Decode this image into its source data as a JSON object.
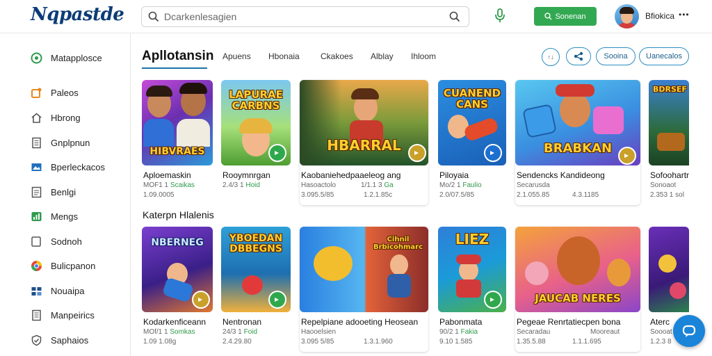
{
  "header": {
    "logo": "Nqpastde",
    "search_placeholder": "Dcarkenlesagien",
    "signin_label": "Sonenan",
    "username": "Bfiokica",
    "menu_glyph": "•••"
  },
  "sidebar": {
    "items": [
      {
        "label": "Matapplosce",
        "icon": "compass-icon"
      },
      {
        "label": "Paleos",
        "icon": "puzzle-icon"
      },
      {
        "label": "Hbrong",
        "icon": "home-icon"
      },
      {
        "label": "Gnplpnun",
        "icon": "document-icon"
      },
      {
        "label": "Bperleckacos",
        "icon": "image-icon"
      },
      {
        "label": "Benlgi",
        "icon": "list-icon"
      },
      {
        "label": "Mengs",
        "icon": "chart-icon"
      },
      {
        "label": "Sodnoh",
        "icon": "folder-icon"
      },
      {
        "label": "Bulicpanon",
        "icon": "globe-icon"
      },
      {
        "label": "Nouaipa",
        "icon": "grid-icon"
      },
      {
        "label": "Manpeirics",
        "icon": "page-icon"
      },
      {
        "label": "Saphaios",
        "icon": "shield-icon"
      }
    ]
  },
  "tabs": {
    "active": "Apllotansin",
    "items": [
      "Apuens",
      "Hbonaia",
      "Ckakoes",
      "Alblay",
      "Ihloom"
    ]
  },
  "toolbar": {
    "circle1_glyph": "↑↓",
    "pill1": "Sooina",
    "pill2": "Uanecalos"
  },
  "row1": [
    {
      "thumb_text": "HIBVRAES",
      "name": "Aploemaskin",
      "meta1a": "MOF1 1",
      "meta1b": "Scaikas",
      "meta2": "1.09.0005"
    },
    {
      "thumb_text": "LAPURAE CARBNS",
      "name": "Rooymnrgan",
      "meta1a": "2.4/3 1",
      "meta1b": "Hoid",
      "meta2": ""
    },
    {
      "thumb_text": "HBARRAL",
      "name": "Kaobaniehedpaaeleog ang",
      "meta1a": "Hasoactolo",
      "meta1b": "1/1.1 3",
      "meta1c": "Ga",
      "meta2": "3.095.5/85",
      "meta2b": "1.2.1.85c"
    },
    {
      "thumb_text": "CUANEND CANS",
      "name": "Piloyaia",
      "meta1a": "Mo/2 1",
      "meta1b": "Faulio",
      "meta2": "2.0/07.5/85"
    },
    {
      "thumb_text": "BRABKAN",
      "name": "Sendencks Kandideong",
      "meta1a": "Secarusda",
      "meta1b": "",
      "meta2": "2.1.055.85",
      "meta2b": "4.3.1185"
    },
    {
      "thumb_text": "BDRSEF",
      "name": "Sofoohartr",
      "meta1a": "Sonoaot",
      "meta1b": "",
      "meta2": "2.353 1 sol"
    }
  ],
  "section_title": "Katerpn Hlalenis",
  "row2": [
    {
      "thumb_text": "NBERNEG",
      "name": "Kodarkenficeann",
      "meta1a": "MOf/1 1",
      "meta1b": "Somkas",
      "meta2": "1.09 1.08g"
    },
    {
      "thumb_text": "YBOEDAN DBBEGNS",
      "name": "Nentronan",
      "meta1a": "24/3 1",
      "meta1b": "Foid",
      "meta2": "2.4.29.80"
    },
    {
      "thumb_text": "Cihnil Brbicohmarc",
      "name": "Repelpiane adooeting Heosean",
      "meta1a": "Haooelsien",
      "meta1b": "",
      "meta2": "3.095 5/85",
      "meta2b": "1.3.1.960"
    },
    {
      "thumb_text": "LIEZ",
      "name": "Pabonmata",
      "meta1a": "90/2 1",
      "meta1b": "Fakia",
      "meta2": "9.10 1.585"
    },
    {
      "thumb_text": "JAUCAB NERES",
      "name": "Pegeae Renrtatiecpen bona",
      "meta1a": "Secaradau",
      "meta1b": "Mooreaut",
      "meta2": "1.35.5.88",
      "meta2b": "1.1.1.695"
    },
    {
      "thumb_text": "",
      "name": "Aterc",
      "meta1a": "Soooat",
      "meta1b": "",
      "meta2": "1.2.3 8"
    }
  ],
  "colors": {
    "accent": "#2b8ec2",
    "signin_green": "#33a852",
    "chat_blue": "#1a84d8",
    "logo_navy": "#0c3c78"
  }
}
